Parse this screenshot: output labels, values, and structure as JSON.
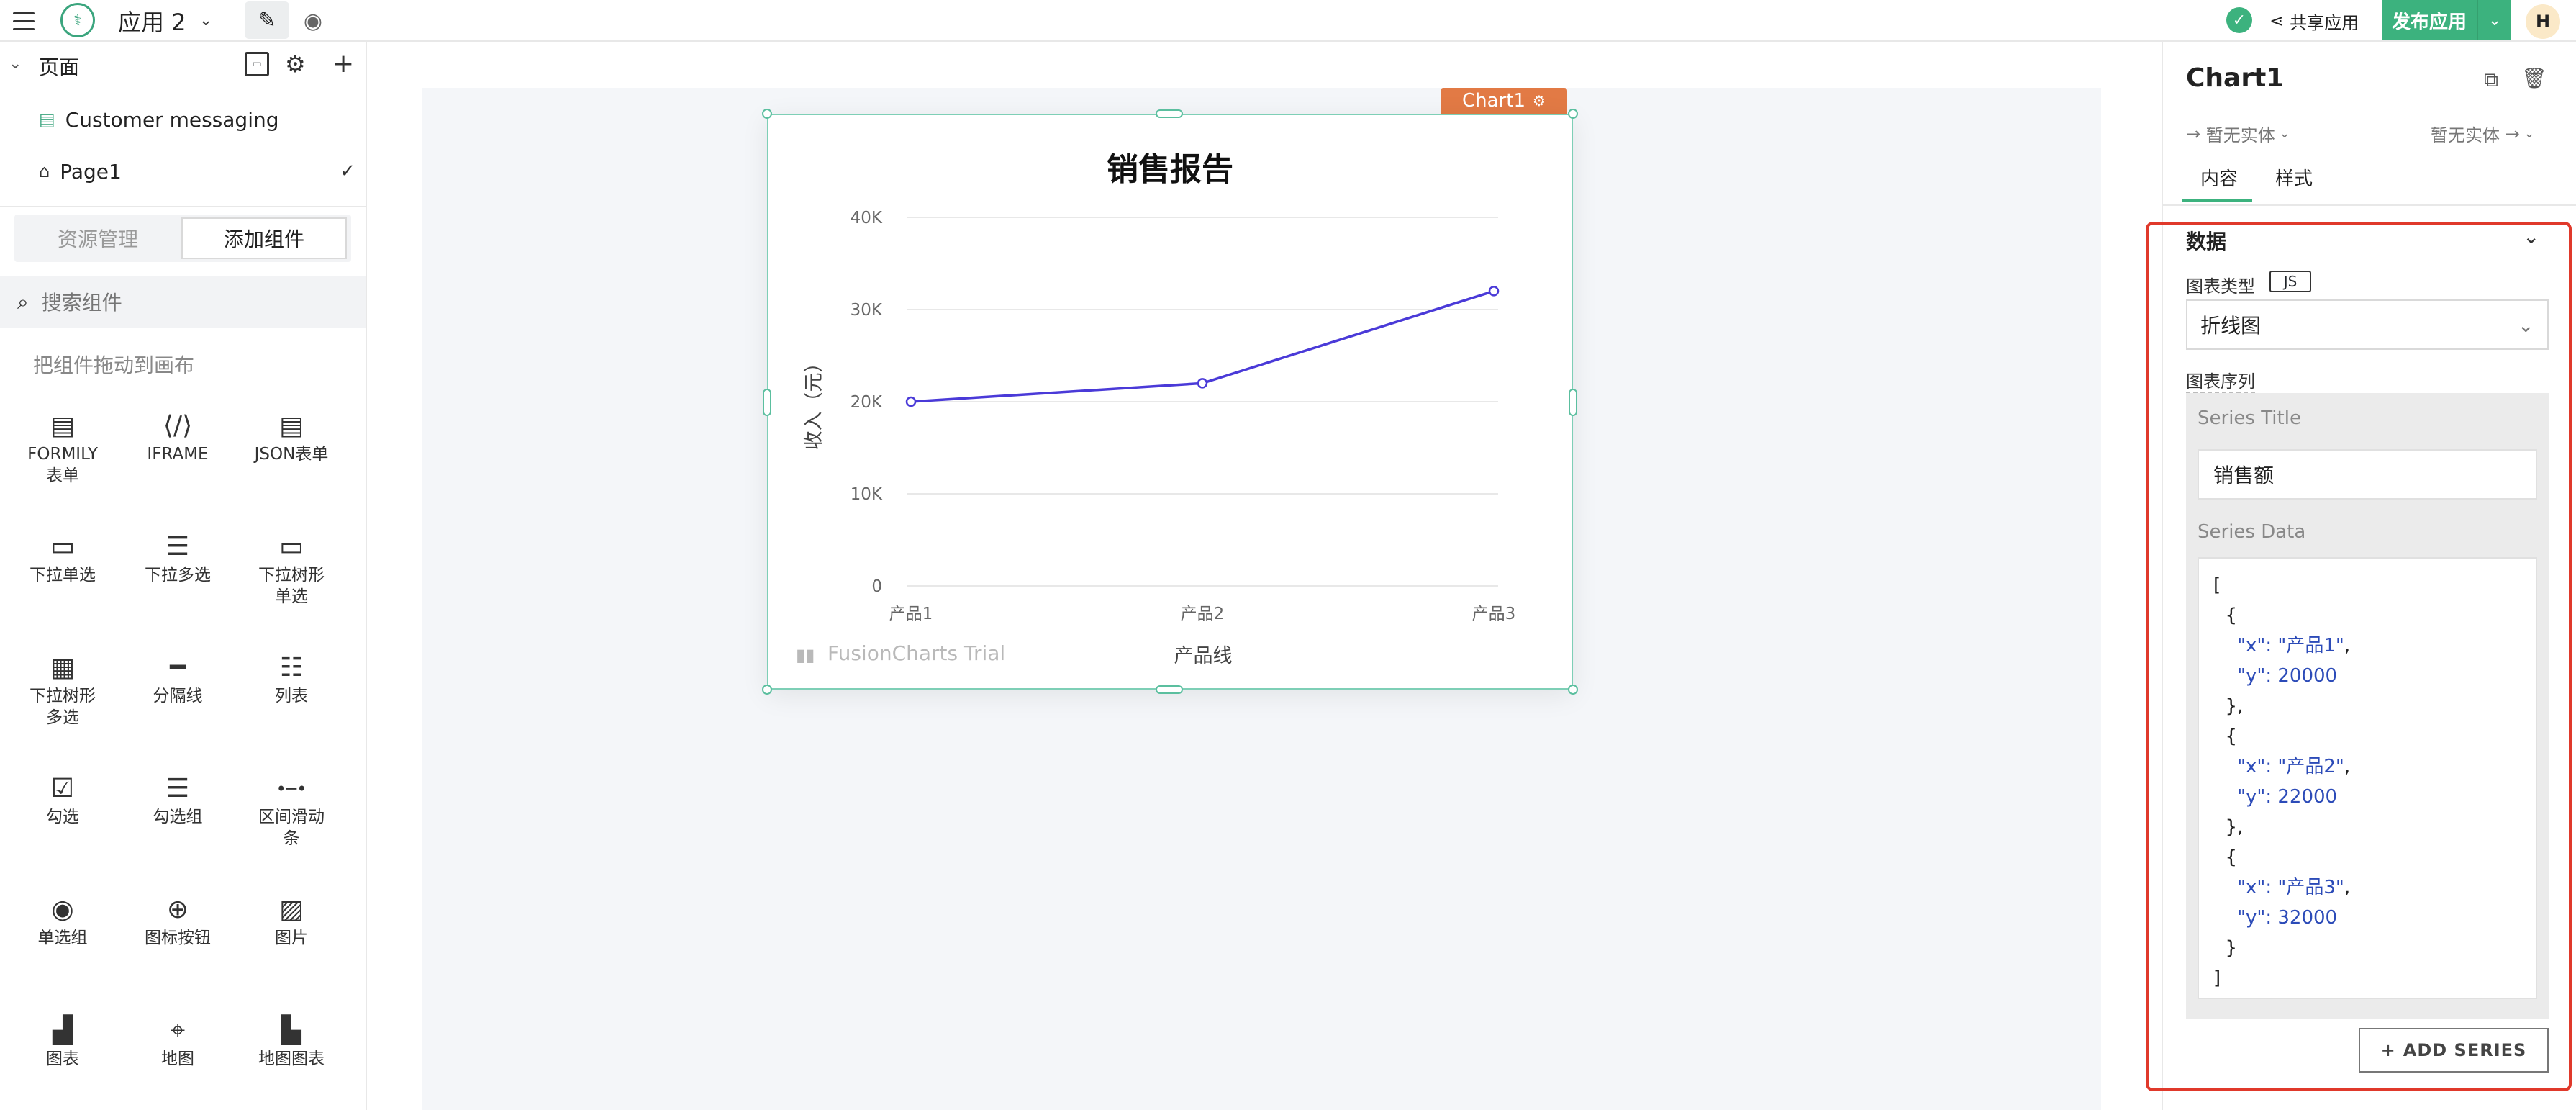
{
  "topbar": {
    "app_name": "应用 2",
    "share_label": "共享应用",
    "publish_label": "发布应用",
    "avatar_initial": "H"
  },
  "left": {
    "pages_title": "页面",
    "pages": [
      {
        "label": "Customer messaging",
        "icon": "table-page-icon"
      },
      {
        "label": "Page1",
        "icon": "home-icon",
        "selected": true
      }
    ],
    "tabs": [
      "资源管理",
      "添加组件"
    ],
    "active_tab": 1,
    "search_placeholder": "搜索组件",
    "drag_hint": "把组件拖动到画布",
    "widgets": [
      {
        "label": "FORMILY\n表单",
        "icon": "form-icon"
      },
      {
        "label": "IFRAME",
        "icon": "iframe-icon"
      },
      {
        "label": "JSON表单",
        "icon": "json-form-icon"
      },
      {
        "label": "下拉单选",
        "icon": "dropdown-icon"
      },
      {
        "label": "下拉多选",
        "icon": "multiselect-icon"
      },
      {
        "label": "下拉树形\n单选",
        "icon": "tree-select-icon"
      },
      {
        "label": "下拉树形\n多选",
        "icon": "tree-multiselect-icon"
      },
      {
        "label": "分隔线",
        "icon": "divider-icon"
      },
      {
        "label": "列表",
        "icon": "list-icon"
      },
      {
        "label": "勾选",
        "icon": "checkbox-icon"
      },
      {
        "label": "勾选组",
        "icon": "checkbox-group-icon"
      },
      {
        "label": "区间滑动\n条",
        "icon": "range-slider-icon"
      },
      {
        "label": "单选组",
        "icon": "radio-group-icon"
      },
      {
        "label": "图标按钮",
        "icon": "icon-button-icon"
      },
      {
        "label": "图片",
        "icon": "image-icon"
      },
      {
        "label": "图表",
        "icon": "chart-icon"
      },
      {
        "label": "地图",
        "icon": "map-pin-icon"
      },
      {
        "label": "地图图表",
        "icon": "map-chart-icon"
      }
    ]
  },
  "chart_widget": {
    "name_tag": "Chart1",
    "watermark": "FusionCharts Trial"
  },
  "chart_data": {
    "type": "line",
    "title": "销售报告",
    "xlabel": "产品线",
    "ylabel": "收入（元）",
    "categories": [
      "产品1",
      "产品2",
      "产品3"
    ],
    "series": [
      {
        "name": "销售额",
        "values": [
          20000,
          22000,
          32000
        ]
      }
    ],
    "ylim": [
      0,
      40000
    ],
    "yticks": [
      "0",
      "10K",
      "20K",
      "30K",
      "40K"
    ],
    "grid": true,
    "line_color": "#4a3ad8"
  },
  "right": {
    "title": "Chart1",
    "entity_left": "暂无实体",
    "entity_right": "暂无实体",
    "tabs": [
      "内容",
      "样式"
    ],
    "section_title": "数据",
    "chart_type_label": "图表类型",
    "js_tag": "JS",
    "chart_type_value": "折线图",
    "series_label": "图表序列",
    "series_title_label": "Series Title",
    "series_title_value": "销售额",
    "series_data_label": "Series Data",
    "series_data": [
      {
        "x": "产品1",
        "y": 20000
      },
      {
        "x": "产品2",
        "y": 22000
      },
      {
        "x": "产品3",
        "y": 32000
      }
    ],
    "add_series_label": "ADD SERIES"
  },
  "colors": {
    "accent": "#3cb27e",
    "tag": "#e27a45",
    "highlight": "#e0392b"
  }
}
